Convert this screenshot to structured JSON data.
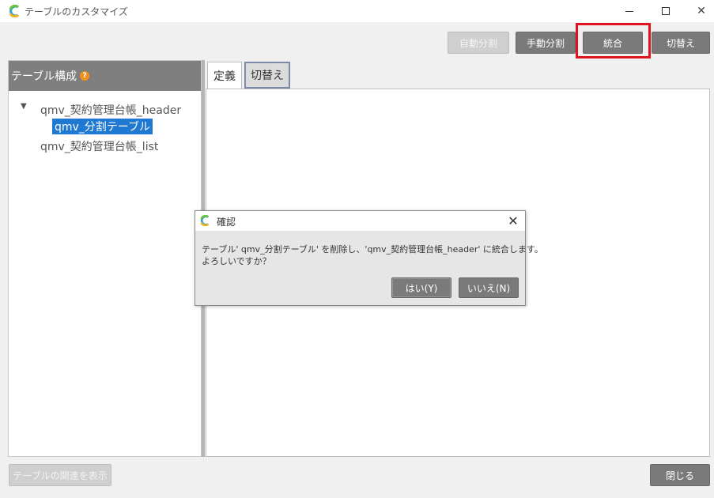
{
  "window": {
    "title": "テーブルのカスタマイズ",
    "app_icon": "app-logo-icon"
  },
  "toolbar": {
    "auto_split_label": "自動分割",
    "manual_split_label": "手動分割",
    "merge_label": "統合",
    "switch_label": "切替え"
  },
  "left_panel": {
    "header_label": "テーブル構成",
    "help_icon": "?",
    "tree_toggle": "▼",
    "tree": [
      {
        "label": "qmv_契約管理台帳_header"
      },
      {
        "label": "qmv_分割テーブル"
      },
      {
        "label": "qmv_契約管理台帳_list"
      }
    ]
  },
  "tabs": [
    {
      "label": "定義"
    },
    {
      "label": "切替え"
    }
  ],
  "footer": {
    "show_relations_label": "テーブルの関連を表示",
    "close_label": "閉じる"
  },
  "dialog": {
    "title": "確認",
    "message_line1": "テーブル' qmv_分割テーブル' を削除し、'qmv_契約管理台帳_header' に統合します。",
    "message_line2": "よろしいですか？",
    "yes_label": "はい(Y)",
    "no_label": "いいえ(N)"
  },
  "colors": {
    "button_gray": "#7a7a7a",
    "highlight_red": "#e0141e",
    "selection_blue": "#1f78d1",
    "help_orange": "#f2921d"
  }
}
